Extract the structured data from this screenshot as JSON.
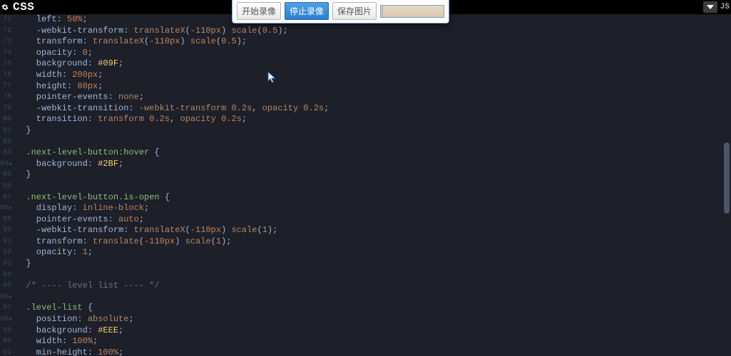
{
  "header": {
    "title": "CSS",
    "js_label": "JS"
  },
  "toolbar": {
    "start_record": "开始录像",
    "stop_record": "停止录像",
    "save_image": "保存图片"
  },
  "gutter_start": 71,
  "arrow_offsets": [
    13,
    17,
    25,
    27
  ],
  "code_lines": [
    [
      [
        "prop",
        "    left"
      ],
      [
        "punct",
        ": "
      ],
      [
        "num",
        "50%"
      ],
      [
        "punct",
        ";"
      ]
    ],
    [
      [
        "prop",
        "    -webkit-transform"
      ],
      [
        "punct",
        ": "
      ],
      [
        "val",
        "translateX"
      ],
      [
        "punct",
        "("
      ],
      [
        "num",
        "-110px"
      ],
      [
        "punct",
        ") "
      ],
      [
        "val",
        "scale"
      ],
      [
        "punct",
        "("
      ],
      [
        "num",
        "0.5"
      ],
      [
        "punct",
        ");"
      ]
    ],
    [
      [
        "prop",
        "    transform"
      ],
      [
        "punct",
        ": "
      ],
      [
        "val",
        "translateX"
      ],
      [
        "punct",
        "("
      ],
      [
        "num",
        "-110px"
      ],
      [
        "punct",
        ") "
      ],
      [
        "val",
        "scale"
      ],
      [
        "punct",
        "("
      ],
      [
        "num",
        "0.5"
      ],
      [
        "punct",
        ");"
      ]
    ],
    [
      [
        "prop",
        "    opacity"
      ],
      [
        "punct",
        ": "
      ],
      [
        "num",
        "0"
      ],
      [
        "punct",
        ";"
      ]
    ],
    [
      [
        "prop",
        "    background"
      ],
      [
        "punct",
        ": "
      ],
      [
        "str",
        "#09F"
      ],
      [
        "punct",
        ";"
      ]
    ],
    [
      [
        "prop",
        "    width"
      ],
      [
        "punct",
        ": "
      ],
      [
        "num",
        "200px"
      ],
      [
        "punct",
        ";"
      ]
    ],
    [
      [
        "prop",
        "    height"
      ],
      [
        "punct",
        ": "
      ],
      [
        "num",
        "80px"
      ],
      [
        "punct",
        ";"
      ]
    ],
    [
      [
        "prop",
        "    pointer-events"
      ],
      [
        "punct",
        ": "
      ],
      [
        "val",
        "none"
      ],
      [
        "punct",
        ";"
      ]
    ],
    [
      [
        "prop",
        "    -webkit-transition"
      ],
      [
        "punct",
        ": "
      ],
      [
        "val",
        "-webkit-transform "
      ],
      [
        "num",
        "0.2s"
      ],
      [
        "punct",
        ", "
      ],
      [
        "val",
        "opacity "
      ],
      [
        "num",
        "0.2s"
      ],
      [
        "punct",
        ";"
      ]
    ],
    [
      [
        "prop",
        "    transition"
      ],
      [
        "punct",
        ": "
      ],
      [
        "val",
        "transform "
      ],
      [
        "num",
        "0.2s"
      ],
      [
        "punct",
        ", "
      ],
      [
        "val",
        "opacity "
      ],
      [
        "num",
        "0.2s"
      ],
      [
        "punct",
        ";"
      ]
    ],
    [
      [
        "punct",
        "  }"
      ]
    ],
    [
      [
        "default",
        ""
      ]
    ],
    [
      [
        "sel",
        "  .next-level-button:hover"
      ],
      [
        "punct",
        " {"
      ]
    ],
    [
      [
        "prop",
        "    background"
      ],
      [
        "punct",
        ": "
      ],
      [
        "str",
        "#2BF"
      ],
      [
        "punct",
        ";"
      ]
    ],
    [
      [
        "punct",
        "  }"
      ]
    ],
    [
      [
        "default",
        ""
      ]
    ],
    [
      [
        "sel",
        "  .next-level-button.is-open"
      ],
      [
        "punct",
        " {"
      ]
    ],
    [
      [
        "prop",
        "    display"
      ],
      [
        "punct",
        ": "
      ],
      [
        "val",
        "inline-block"
      ],
      [
        "punct",
        ";"
      ]
    ],
    [
      [
        "prop",
        "    pointer-events"
      ],
      [
        "punct",
        ": "
      ],
      [
        "val",
        "auto"
      ],
      [
        "punct",
        ";"
      ]
    ],
    [
      [
        "prop",
        "    -webkit-transform"
      ],
      [
        "punct",
        ": "
      ],
      [
        "val",
        "translateX"
      ],
      [
        "punct",
        "("
      ],
      [
        "num",
        "-110px"
      ],
      [
        "punct",
        ") "
      ],
      [
        "val",
        "scale"
      ],
      [
        "punct",
        "("
      ],
      [
        "num",
        "1"
      ],
      [
        "punct",
        ");"
      ]
    ],
    [
      [
        "prop",
        "    transform"
      ],
      [
        "punct",
        ": "
      ],
      [
        "val",
        "translate"
      ],
      [
        "punct",
        "("
      ],
      [
        "num",
        "-110px"
      ],
      [
        "punct",
        ") "
      ],
      [
        "val",
        "scale"
      ],
      [
        "punct",
        "("
      ],
      [
        "num",
        "1"
      ],
      [
        "punct",
        ");"
      ]
    ],
    [
      [
        "prop",
        "    opacity"
      ],
      [
        "punct",
        ": "
      ],
      [
        "num",
        "1"
      ],
      [
        "punct",
        ";"
      ]
    ],
    [
      [
        "punct",
        "  }"
      ]
    ],
    [
      [
        "default",
        ""
      ]
    ],
    [
      [
        "comment",
        "  /* ---- level list ---- */"
      ]
    ],
    [
      [
        "default",
        ""
      ]
    ],
    [
      [
        "sel",
        "  .level-list"
      ],
      [
        "punct",
        " {"
      ]
    ],
    [
      [
        "prop",
        "    position"
      ],
      [
        "punct",
        ": "
      ],
      [
        "val",
        "absolute"
      ],
      [
        "punct",
        ";"
      ]
    ],
    [
      [
        "prop",
        "    background"
      ],
      [
        "punct",
        ": "
      ],
      [
        "str",
        "#EEE"
      ],
      [
        "punct",
        ";"
      ]
    ],
    [
      [
        "prop",
        "    width"
      ],
      [
        "punct",
        ": "
      ],
      [
        "num",
        "100%"
      ],
      [
        "punct",
        ";"
      ]
    ],
    [
      [
        "prop",
        "    min-height"
      ],
      [
        "punct",
        ": "
      ],
      [
        "num",
        "100%"
      ],
      [
        "punct",
        ";"
      ]
    ]
  ]
}
